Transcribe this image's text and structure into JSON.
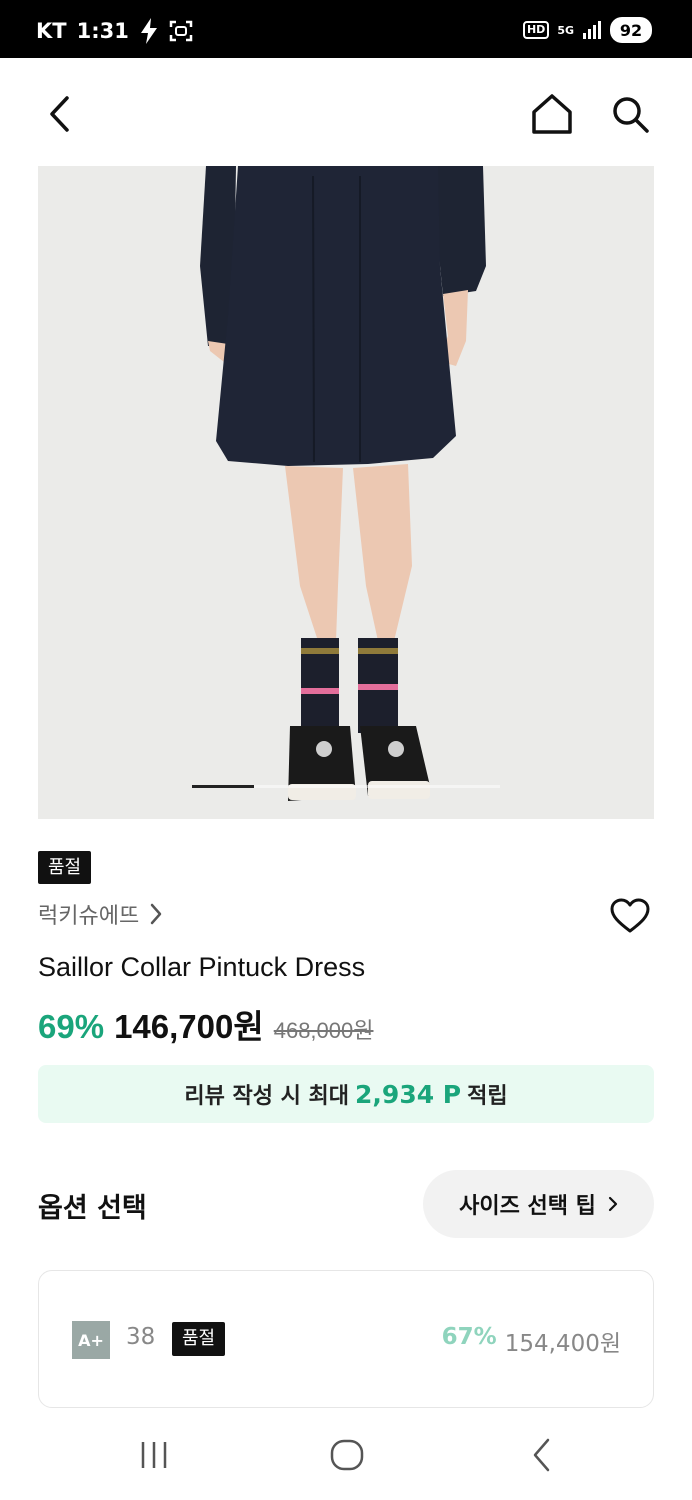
{
  "status_bar": {
    "carrier": "KT",
    "time": "1:31",
    "hd": "HD",
    "network": "5G",
    "battery": "92"
  },
  "header": {
    "back_icon": "chevron-left-icon",
    "home_icon": "home-icon",
    "search_icon": "search-icon"
  },
  "product": {
    "soldout_tag": "품절",
    "brand": "럭키슈에뜨",
    "name": "Saillor Collar Pintuck Dress",
    "discount": "69%",
    "price": "146,700원",
    "original_price": "468,000원",
    "carousel": {
      "current": 1,
      "total": 5
    }
  },
  "reward": {
    "prefix": "리뷰 작성 시 최대",
    "amount": "2,934 P",
    "suffix": "적립"
  },
  "options": {
    "title": "옵션 선택",
    "size_tip_label": "사이즈 선택 팁",
    "items": [
      {
        "grade": "A+",
        "size": "38",
        "status": "품절",
        "discount": "67%",
        "price": "154,400원"
      }
    ]
  },
  "colors": {
    "accent": "#1aa57b",
    "reward_bg": "#e9faf2",
    "soldout_bg": "#111111"
  }
}
